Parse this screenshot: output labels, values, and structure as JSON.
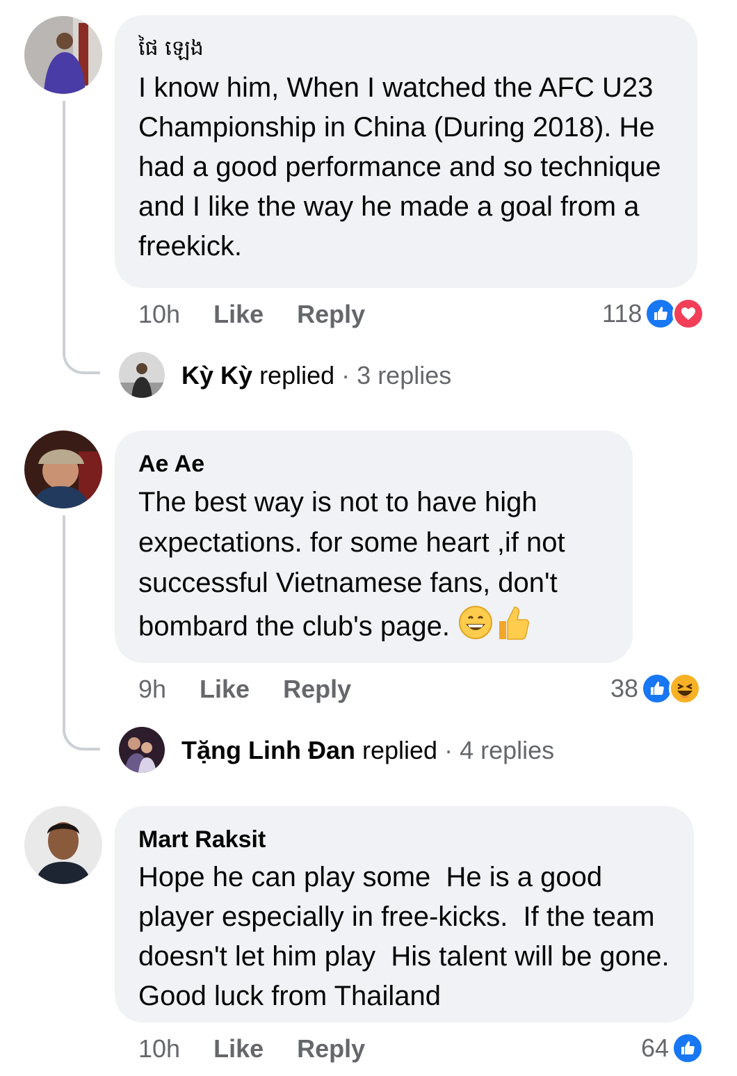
{
  "comments": [
    {
      "author": "ផៃ ឡេង",
      "text": "I know him, When I watched the AFC U23 Championship in China (During 2018). He had a good performance and so technique and I like the way he made a goal from a freekick.",
      "time": "10h",
      "like_label": "Like",
      "reply_label": "Reply",
      "reaction_count": "118",
      "reactions": [
        "like-icon",
        "love-icon"
      ],
      "thread": {
        "name": "Kỳ Kỳ",
        "verb": "replied",
        "separator": "·",
        "count": "3 replies"
      }
    },
    {
      "author": "Ae Ae",
      "text": "The best way is not to have high expectations. for some heart ,if not successful Vietnamese fans, don't bombard the club's page.",
      "emojis": [
        "grinning-emoji",
        "thumbs-up-emoji"
      ],
      "time": "9h",
      "like_label": "Like",
      "reply_label": "Reply",
      "reaction_count": "38",
      "reactions": [
        "like-icon",
        "haha-icon"
      ],
      "thread": {
        "name": "Tặng Linh Đan",
        "verb": "replied",
        "separator": "·",
        "count": "4 replies"
      }
    },
    {
      "author": "Mart Raksit",
      "text": "Hope he can play some  He is a good player especially in free-kicks.  If the team doesn't let him play  His talent will be gone.  Good luck from Thailand",
      "time": "10h",
      "like_label": "Like",
      "reply_label": "Reply",
      "reaction_count": "64",
      "reactions": [
        "like-icon"
      ]
    }
  ],
  "colors": {
    "bubble": "#f0f2f5",
    "meta_text": "#65676b",
    "like_blue": "#1877f2",
    "love_red": "#f33e58",
    "haha_yellow": "#f7b125"
  }
}
